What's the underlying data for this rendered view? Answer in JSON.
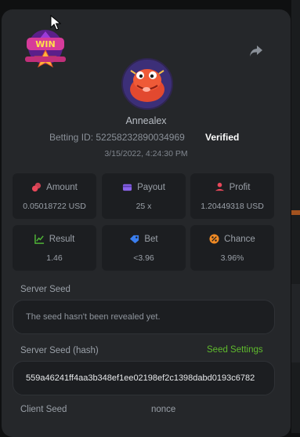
{
  "header": {
    "badge_icon": "win-badge-icon",
    "share_icon": "share-icon"
  },
  "player": {
    "username": "Annealex",
    "betting_id": "Betting ID: 52258232890034969",
    "verified": "Verified",
    "datetime": "3/15/2022, 4:24:30 PM"
  },
  "stats": [
    {
      "label": "Amount",
      "value": "0.05018722 USD",
      "icon": "coins-icon",
      "color": "#e8485a"
    },
    {
      "label": "Payout",
      "value": "25 x",
      "icon": "wallet-icon",
      "color": "#8a63e8"
    },
    {
      "label": "Profit",
      "value": "1.20449318 USD",
      "icon": "profit-icon",
      "color": "#e8485a"
    },
    {
      "label": "Result",
      "value": "1.46",
      "icon": "chart-icon",
      "color": "#4fb337"
    },
    {
      "label": "Bet",
      "value": "<3.96",
      "icon": "tag-icon",
      "color": "#3b7ff0"
    },
    {
      "label": "Chance",
      "value": "3.96%",
      "icon": "percent-icon",
      "color": "#f08a24"
    }
  ],
  "seeds": {
    "server_seed_label": "Server Seed",
    "server_seed_value": "The seed hasn't been revealed yet.",
    "server_hash_label": "Server Seed (hash)",
    "seed_settings": "Seed Settings",
    "server_hash_value": "559a46241ff4aa3b348ef1ee02198ef2c1398dabd0193c6782",
    "client_seed_label": "Client Seed",
    "nonce_label": "nonce"
  }
}
